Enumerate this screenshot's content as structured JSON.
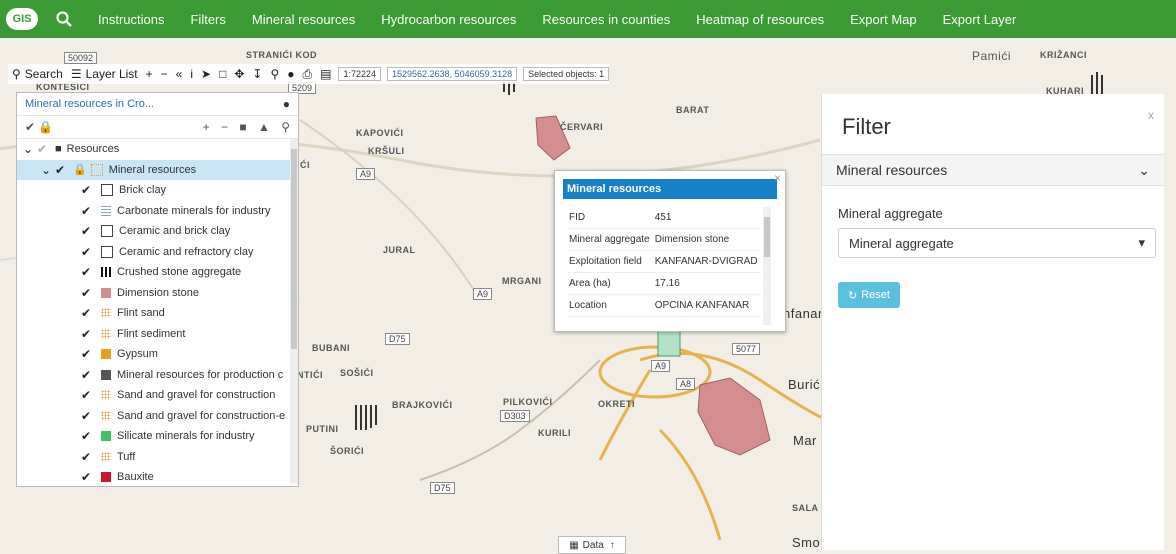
{
  "topbar": {
    "logo_text": "GIS",
    "menu": [
      "Instructions",
      "Filters",
      "Mineral resources",
      "Hydrocarbon resources",
      "Resources in counties",
      "Heatmap of resources",
      "Export Map",
      "Export Layer"
    ]
  },
  "toolbar": {
    "search_label": "Search",
    "layerlist_label": "Layer List",
    "scale": "1:72224",
    "coords": "1529562.2638, 5046059.3128",
    "selected": "Selected objects: 1"
  },
  "layer_panel": {
    "title": "Mineral resources in Cro...",
    "group": "Resources",
    "layer": "Mineral resources",
    "items": [
      {
        "label": "Brick clay",
        "symbol": "outline"
      },
      {
        "label": "Carbonate minerals for industry",
        "symbol": "lines"
      },
      {
        "label": "Ceramic and brick clay",
        "symbol": "outline"
      },
      {
        "label": "Ceramic and refractory clay",
        "symbol": "outline"
      },
      {
        "label": "Crushed stone aggregate",
        "symbol": "vbars"
      },
      {
        "label": "Dimension stone",
        "symbol": "pink"
      },
      {
        "label": "Flint sand",
        "symbol": "dots"
      },
      {
        "label": "Flint sediment",
        "symbol": "dots"
      },
      {
        "label": "Gypsum",
        "symbol": "orange"
      },
      {
        "label": "Mineral resources for production c",
        "symbol": "dark"
      },
      {
        "label": "Sand and gravel for construction",
        "symbol": "dots"
      },
      {
        "label": "Sand and gravel for construction-e",
        "symbol": "dots"
      },
      {
        "label": "Silicate minerals for industry",
        "symbol": "green"
      },
      {
        "label": "Tuff",
        "symbol": "dots"
      },
      {
        "label": "Bauxite",
        "symbol": "red"
      }
    ]
  },
  "popup": {
    "title": "Mineral resources",
    "rows": [
      {
        "k": "FID",
        "v": "451"
      },
      {
        "k": "Mineral aggregate",
        "v": "Dimension stone"
      },
      {
        "k": "Exploitation field",
        "v": "KANFANAR-DVIGRAD"
      },
      {
        "k": "Area (ha)",
        "v": "17.16"
      },
      {
        "k": "Location",
        "v": "OPCINA KANFANAR"
      }
    ]
  },
  "filter": {
    "title": "Filter",
    "close": "x",
    "section": "Mineral resources",
    "field_label": "Mineral aggregate",
    "select_value": "Mineral aggregate",
    "reset_label": "Reset"
  },
  "databar": {
    "label": "Data"
  },
  "map_labels": [
    {
      "text": "STRANIĆI KOD"
    },
    {
      "text": "KONTEŠIĆI"
    },
    {
      "text": "KAPOVIĆI"
    },
    {
      "text": "KRŠULI"
    },
    {
      "text": "ČERVARI"
    },
    {
      "text": "BARAT"
    },
    {
      "text": "JURAL"
    },
    {
      "text": "MRGANI"
    },
    {
      "text": "BUBANI"
    },
    {
      "text": "SOŠIĆI"
    },
    {
      "text": "BRAJKOVIĆI"
    },
    {
      "text": "PILKOVIĆI"
    },
    {
      "text": "OKRETI"
    },
    {
      "text": "KURILI"
    },
    {
      "text": "PUTINI"
    },
    {
      "text": "ŠORIĆI"
    },
    {
      "text": "KRIŽANCI"
    },
    {
      "text": "KUHARI"
    },
    {
      "text": "Pamići"
    },
    {
      "text": "Burići"
    },
    {
      "text": "nfanar"
    },
    {
      "text": "Mar"
    },
    {
      "text": "SALA"
    },
    {
      "text": "Smo"
    },
    {
      "text": "UNTIĆI"
    },
    {
      "text": "ČIĆI"
    }
  ],
  "road_labels": [
    "A9",
    "A9",
    "A9",
    "A8",
    "D75",
    "D75",
    "D303",
    "5077",
    "5209",
    "50092"
  ]
}
